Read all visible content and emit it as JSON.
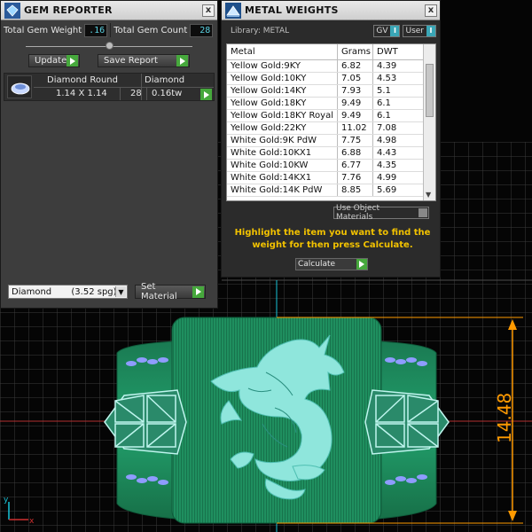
{
  "gem_reporter": {
    "title": "GEM REPORTER",
    "close_glyph": "x",
    "total_gem_weight_label": "Total Gem Weight",
    "total_gem_weight_value": ".16",
    "total_gem_count_label": "Total Gem Count",
    "total_gem_count_value": "28",
    "update_label": "Update",
    "save_report_label": "Save Report",
    "gem_list": {
      "shape": "Diamond Round",
      "material": "Diamond",
      "size": "1.14 X 1.14",
      "count": "28",
      "weight": "0.16tw"
    },
    "material_select": "Diamond       (3.52 spg)",
    "set_material_label": "Set Material"
  },
  "metal_weights": {
    "title": "METAL WEIGHTS",
    "close_glyph": "x",
    "library_label": "Library: METAL",
    "gv_label": "GV",
    "gv_box": "I",
    "user_label": "User",
    "user_box": "I",
    "columns": [
      "Metal",
      "Grams",
      "DWT"
    ],
    "rows": [
      [
        "Yellow Gold:9KY",
        "6.82",
        "4.39"
      ],
      [
        "Yellow Gold:10KY",
        "7.05",
        "4.53"
      ],
      [
        "Yellow Gold:14KY",
        "7.93",
        "5.1"
      ],
      [
        "Yellow Gold:18KY",
        "9.49",
        "6.1"
      ],
      [
        "Yellow Gold:18KY Royal",
        "9.49",
        "6.1"
      ],
      [
        "Yellow Gold:22KY",
        "11.02",
        "7.08"
      ],
      [
        "White Gold:9K PdW",
        "7.75",
        "4.98"
      ],
      [
        "White Gold:10KX1",
        "6.88",
        "4.43"
      ],
      [
        "White Gold:10KW",
        "6.77",
        "4.35"
      ],
      [
        "White Gold:14KX1",
        "7.76",
        "4.99"
      ],
      [
        "White Gold:14K PdW",
        "8.85",
        "5.69"
      ]
    ],
    "use_object_materials_label": "Use Object Materials",
    "hint_text": "Highlight the item you want to find the weight for then press Calculate.",
    "calculate_label": "Calculate"
  },
  "viewport": {
    "dimension_value": "14.48",
    "axis_x_label": "x",
    "axis_y_label": "y"
  },
  "colors": {
    "ring_green": "#1f8f5f",
    "engraving": "#8fe6dc",
    "accent_blue": "#8f9cff",
    "dimension_orange": "#ff9a00",
    "panel_green_button": "#46a83c",
    "hint_yellow": "#f2c200"
  }
}
